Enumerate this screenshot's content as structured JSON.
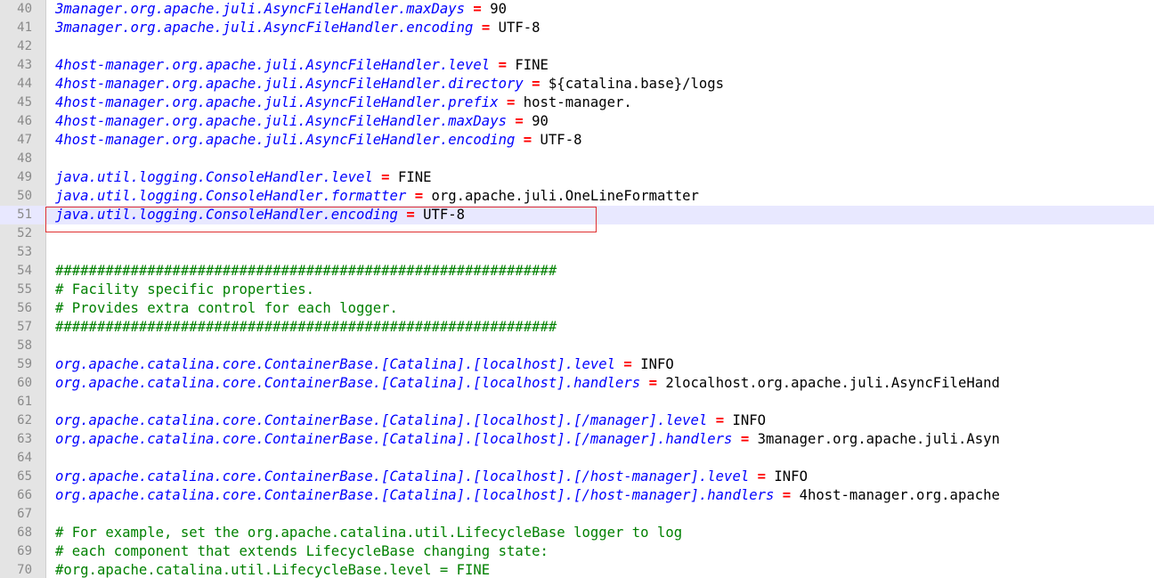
{
  "lines": [
    {
      "n": "40",
      "type": "prop",
      "key": "3manager.org.apache.juli.AsyncFileHandler.maxDays",
      "value": "90"
    },
    {
      "n": "41",
      "type": "prop",
      "key": "3manager.org.apache.juli.AsyncFileHandler.encoding",
      "value": "UTF-8"
    },
    {
      "n": "42",
      "type": "blank"
    },
    {
      "n": "43",
      "type": "prop",
      "key": "4host-manager.org.apache.juli.AsyncFileHandler.level",
      "value": "FINE"
    },
    {
      "n": "44",
      "type": "prop",
      "key": "4host-manager.org.apache.juli.AsyncFileHandler.directory",
      "value": "${catalina.base}/logs"
    },
    {
      "n": "45",
      "type": "prop",
      "key": "4host-manager.org.apache.juli.AsyncFileHandler.prefix",
      "value": "host-manager."
    },
    {
      "n": "46",
      "type": "prop",
      "key": "4host-manager.org.apache.juli.AsyncFileHandler.maxDays",
      "value": "90"
    },
    {
      "n": "47",
      "type": "prop",
      "key": "4host-manager.org.apache.juli.AsyncFileHandler.encoding",
      "value": "UTF-8"
    },
    {
      "n": "48",
      "type": "blank"
    },
    {
      "n": "49",
      "type": "prop",
      "key": "java.util.logging.ConsoleHandler.level",
      "value": "FINE"
    },
    {
      "n": "50",
      "type": "prop",
      "key": "java.util.logging.ConsoleHandler.formatter",
      "value": "org.apache.juli.OneLineFormatter"
    },
    {
      "n": "51",
      "type": "prop",
      "key": "java.util.logging.ConsoleHandler.encoding",
      "value": "UTF-8",
      "current": true
    },
    {
      "n": "52",
      "type": "blank"
    },
    {
      "n": "53",
      "type": "blank"
    },
    {
      "n": "54",
      "type": "comment",
      "text": "############################################################"
    },
    {
      "n": "55",
      "type": "comment",
      "text": "# Facility specific properties."
    },
    {
      "n": "56",
      "type": "comment",
      "text": "# Provides extra control for each logger."
    },
    {
      "n": "57",
      "type": "comment",
      "text": "############################################################"
    },
    {
      "n": "58",
      "type": "blank"
    },
    {
      "n": "59",
      "type": "prop",
      "key": "org.apache.catalina.core.ContainerBase.[Catalina].[localhost].level",
      "value": "INFO"
    },
    {
      "n": "60",
      "type": "prop",
      "key": "org.apache.catalina.core.ContainerBase.[Catalina].[localhost].handlers",
      "value": "2localhost.org.apache.juli.AsyncFileHand"
    },
    {
      "n": "61",
      "type": "blank"
    },
    {
      "n": "62",
      "type": "prop",
      "key": "org.apache.catalina.core.ContainerBase.[Catalina].[localhost].[/manager].level",
      "value": "INFO"
    },
    {
      "n": "63",
      "type": "prop",
      "key": "org.apache.catalina.core.ContainerBase.[Catalina].[localhost].[/manager].handlers",
      "value": "3manager.org.apache.juli.Asyn"
    },
    {
      "n": "64",
      "type": "blank"
    },
    {
      "n": "65",
      "type": "prop",
      "key": "org.apache.catalina.core.ContainerBase.[Catalina].[localhost].[/host-manager].level",
      "value": "INFO"
    },
    {
      "n": "66",
      "type": "prop",
      "key": "org.apache.catalina.core.ContainerBase.[Catalina].[localhost].[/host-manager].handlers",
      "value": "4host-manager.org.apache"
    },
    {
      "n": "67",
      "type": "blank"
    },
    {
      "n": "68",
      "type": "comment",
      "text": "# For example, set the org.apache.catalina.util.LifecycleBase logger to log"
    },
    {
      "n": "69",
      "type": "comment",
      "text": "# each component that extends LifecycleBase changing state:"
    },
    {
      "n": "70",
      "type": "comment",
      "text": "#org.apache.catalina.util.LifecycleBase.level = FINE"
    }
  ],
  "operator": "=",
  "highlighted_line": "51"
}
